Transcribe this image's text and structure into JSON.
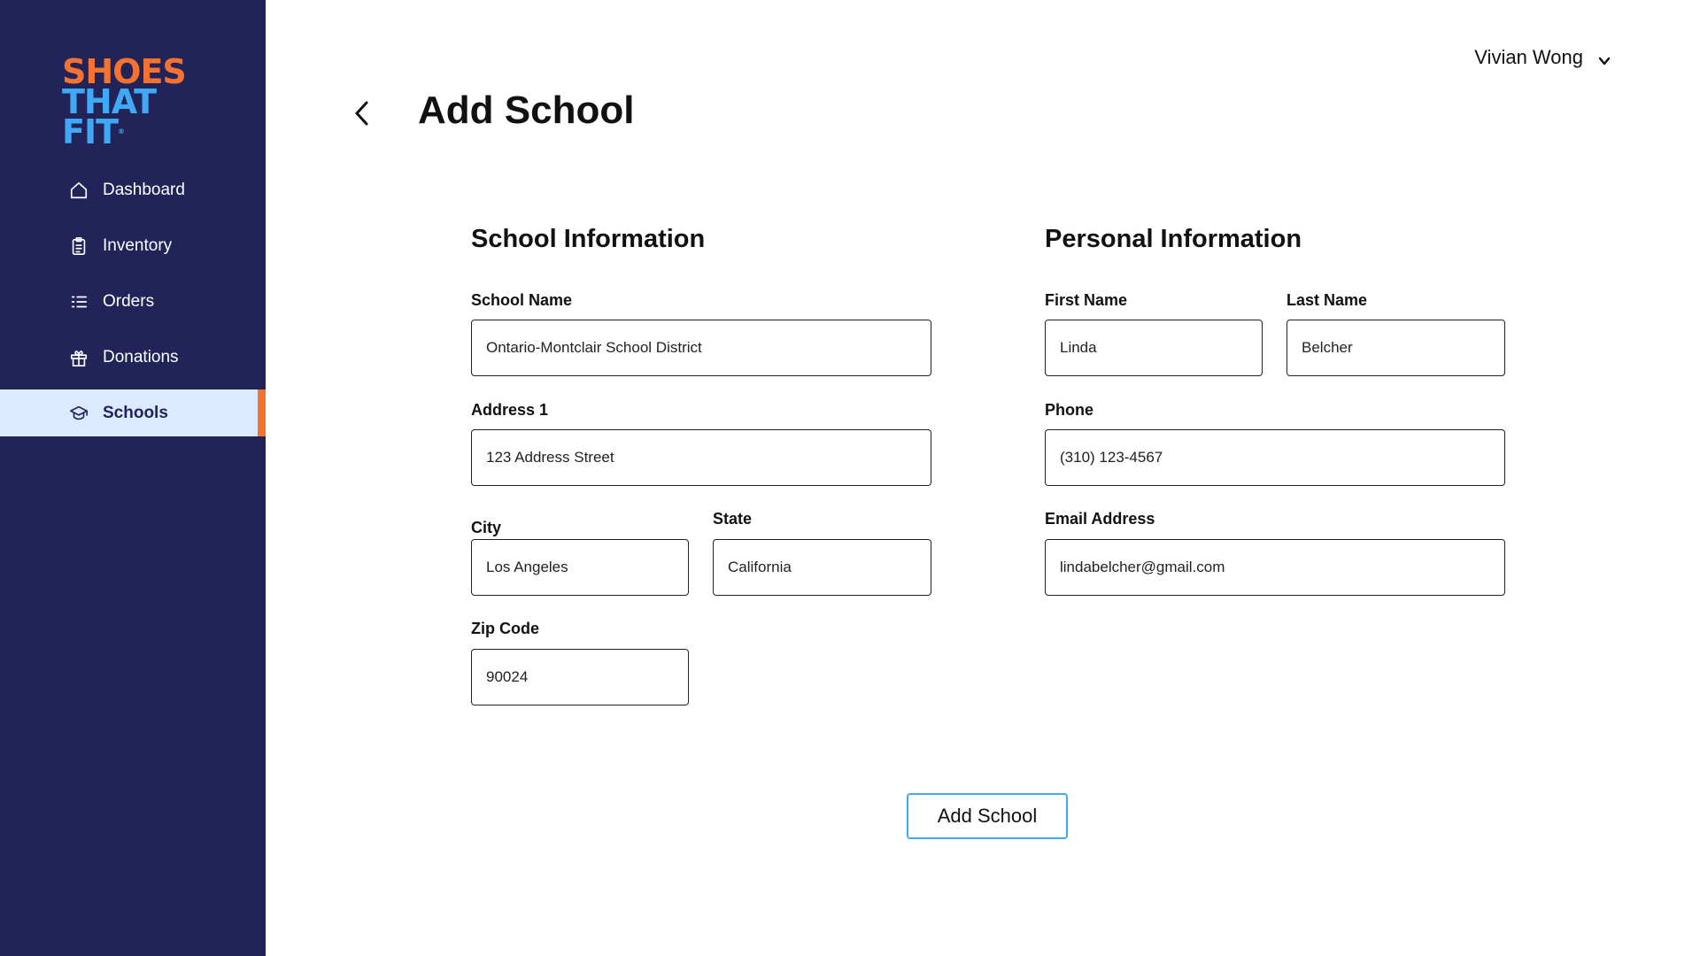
{
  "brand": {
    "logo_line1": "SHOES",
    "logo_line2": "THAT FIT",
    "logo_tm": "®"
  },
  "sidebar": {
    "items": [
      {
        "label": "Dashboard",
        "icon": "home-icon"
      },
      {
        "label": "Inventory",
        "icon": "clipboard-icon"
      },
      {
        "label": "Orders",
        "icon": "list-icon"
      },
      {
        "label": "Donations",
        "icon": "gift-icon"
      },
      {
        "label": "Schools",
        "icon": "graduation-cap-icon",
        "active": true
      }
    ]
  },
  "header": {
    "user_name": "Vivian Wong",
    "title": "Add School"
  },
  "school_info": {
    "title": "School Information",
    "school_name_label": "School Name",
    "school_name_value": "Ontario-Montclair School District",
    "address1_label": "Address 1",
    "address1_value": "123 Address Street",
    "city_label": "City",
    "city_value": "Los Angeles",
    "state_label": "State",
    "state_value": "California",
    "zip_label": "Zip Code",
    "zip_value": "90024"
  },
  "personal_info": {
    "title": "Personal Information",
    "first_name_label": "First Name",
    "first_name_value": "Linda",
    "last_name_label": "Last Name",
    "last_name_value": "Belcher",
    "phone_label": "Phone",
    "phone_value": "(310) 123-4567",
    "email_label": "Email Address",
    "email_value": "lindabelcher@gmail.com"
  },
  "actions": {
    "submit_label": "Add School"
  },
  "colors": {
    "sidebar_bg": "#222459",
    "accent_orange": "#f47332",
    "accent_blue": "#3fa9f5",
    "active_bg": "#dbeafe"
  }
}
